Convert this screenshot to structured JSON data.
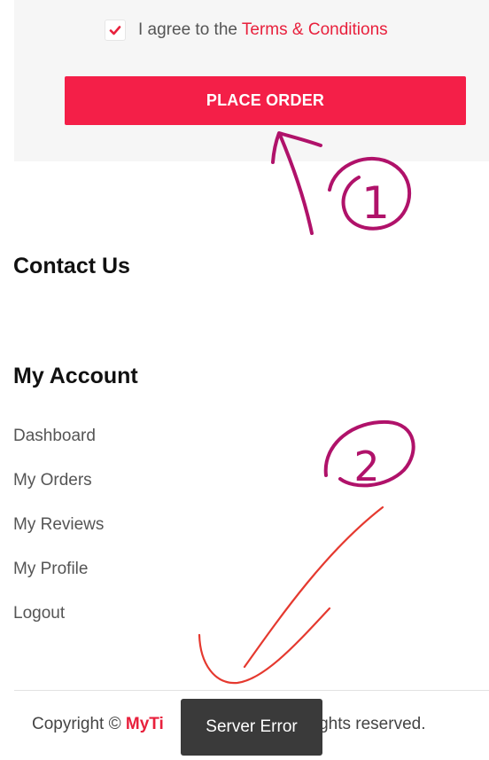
{
  "checkout": {
    "agree_prefix": "I agree to the",
    "terms_link": "Terms & Conditions",
    "agree_checked": true,
    "place_order_label": "PLACE ORDER"
  },
  "sections": {
    "contact_title": "Contact Us",
    "account_title": "My Account"
  },
  "account_links": [
    {
      "label": "Dashboard"
    },
    {
      "label": "My Orders"
    },
    {
      "label": "My Reviews"
    },
    {
      "label": "My Profile"
    },
    {
      "label": "Logout"
    }
  ],
  "footer": {
    "copyright_prefix": "Copyright ©",
    "brand_visible": "MyTi",
    "copyright_suffix": "ll rights reserved."
  },
  "toast": {
    "message": "Server Error"
  },
  "annotations": {
    "marker_1": "1",
    "marker_2": "2"
  },
  "colors": {
    "accent": "#f41f48",
    "link": "#e8203c",
    "panel_bg": "#f6f6f6",
    "toast_bg": "#3a3a3a",
    "annotation_purple": "#b0126a",
    "annotation_red": "#e5392f"
  }
}
